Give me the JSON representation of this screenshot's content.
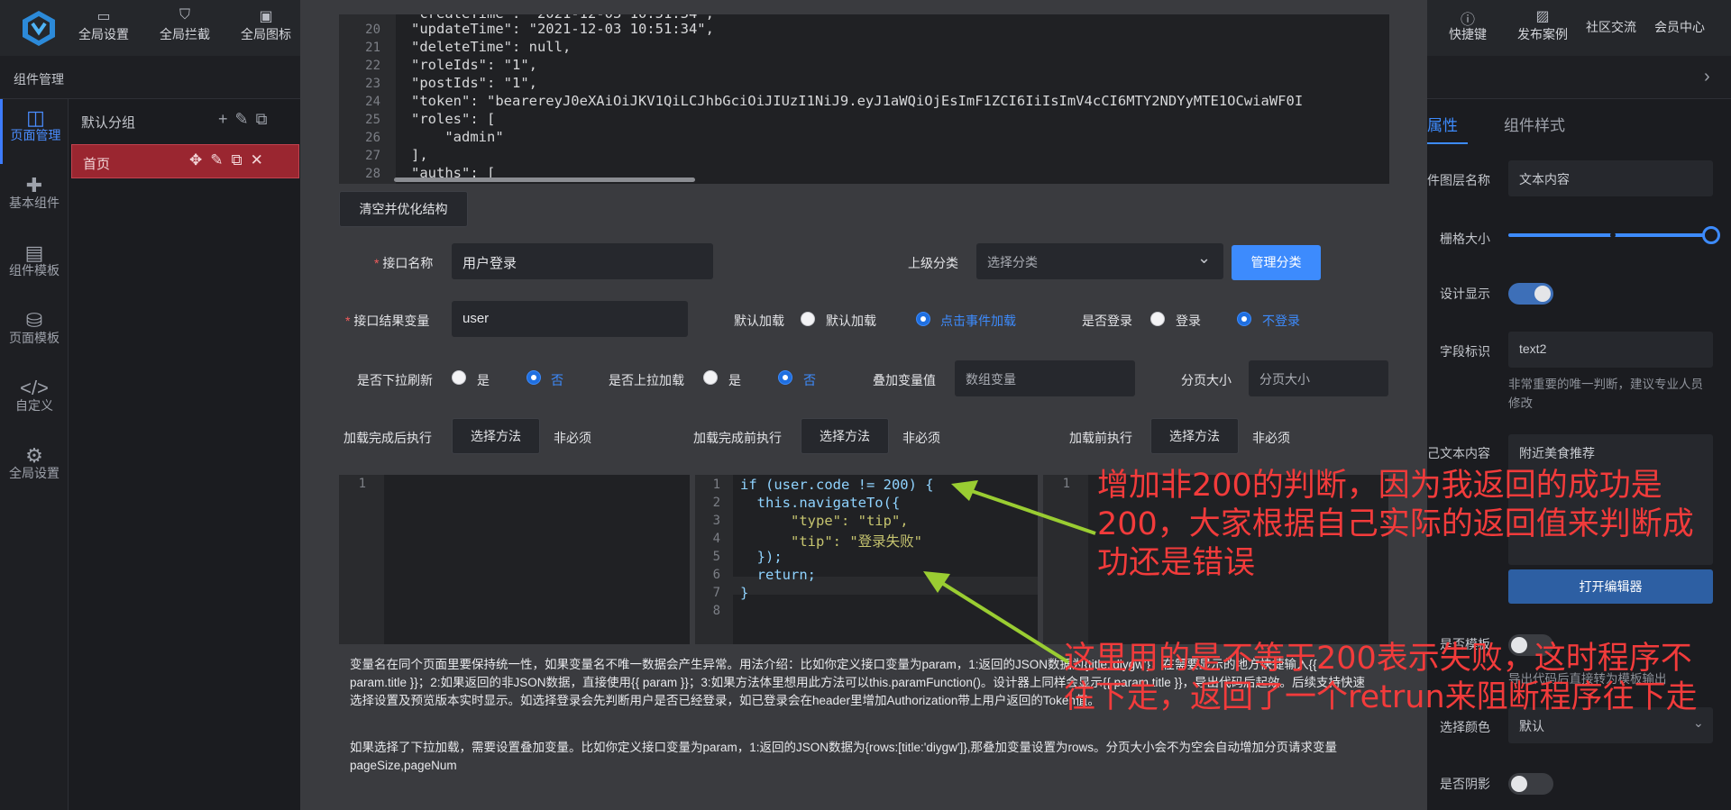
{
  "topbar": {
    "left_buttons": [
      {
        "label": "全局设置",
        "icon": "settings-icon"
      },
      {
        "label": "全局拦截",
        "icon": "shield-icon"
      },
      {
        "label": "全局图标",
        "icon": "icon-library-icon"
      }
    ],
    "right_buttons": [
      {
        "label": "快捷键",
        "icon": "help-icon"
      },
      {
        "label": "发布案例",
        "icon": "image-icon"
      },
      {
        "label": "社区交流"
      },
      {
        "label": "会员中心"
      }
    ]
  },
  "subbar": {
    "title": "组件管理"
  },
  "leftnav": {
    "items": [
      {
        "label": "页面管理",
        "icon": "page-icon",
        "active": true
      },
      {
        "label": "基本组件",
        "icon": "puzzle-icon"
      },
      {
        "label": "组件模板",
        "icon": "template-icon"
      },
      {
        "label": "页面模板",
        "icon": "database-icon"
      },
      {
        "label": "自定义",
        "icon": "code-icon"
      },
      {
        "label": "全局设置",
        "icon": "gear-icon"
      }
    ]
  },
  "pages_panel": {
    "group_title": "默认分组",
    "pages": [
      {
        "label": "首页"
      }
    ]
  },
  "code_top": {
    "lines": [
      {
        "n": "20",
        "code": "\"updateTime\": \"2021-12-03 10:51:34\","
      },
      {
        "n": "21",
        "code": "\"deleteTime\": null,"
      },
      {
        "n": "22",
        "code": "\"roleIds\": \"1\","
      },
      {
        "n": "23",
        "code": "\"postIds\": \"1\","
      },
      {
        "n": "24",
        "code": "\"token\": \"bearereyJ0eXAiOiJKV1QiLCJhbGciOiJIUzI1NiJ9.eyJ1aWQiOjEsImF1ZCI6IiIsImV4cCI6MTY2NDYyMTE1OCwiaWF0I"
      },
      {
        "n": "25",
        "code": "\"roles\": ["
      },
      {
        "n": "26",
        "code": "    \"admin\""
      },
      {
        "n": "27",
        "code": "],"
      },
      {
        "n": "28",
        "code": "\"auths\": ["
      }
    ]
  },
  "form": {
    "clear_button": "清空并优化结构",
    "api_name_label": "接口名称",
    "api_name_value": "用户登录",
    "parent_category_label": "上级分类",
    "parent_category_placeholder": "选择分类",
    "manage_category_button": "管理分类",
    "result_var_label": "接口结果变量",
    "result_var_value": "user",
    "default_load_label": "默认加载",
    "default_load_opt1": "默认加载",
    "default_load_opt2": "点击事件加载",
    "need_login_label": "是否登录",
    "need_login_opt1": "登录",
    "need_login_opt2": "不登录",
    "pull_refresh_label": "是否下拉刷新",
    "pull_up_label": "是否上拉加载",
    "yes": "是",
    "no": "否",
    "stack_var_label": "叠加变量值",
    "stack_var_placeholder": "数组变量",
    "page_size_label": "分页大小",
    "page_size_placeholder": "分页大小",
    "after_load_label": "加载完成后执行",
    "before_complete_label": "加载完成前执行",
    "before_load_label": "加载前执行",
    "choose_method": "选择方法",
    "optional": "非必须"
  },
  "editors": {
    "left": {
      "lines": [
        "1"
      ]
    },
    "middle": {
      "lines": [
        {
          "n": "1",
          "code": "if (user.code != 200) {"
        },
        {
          "n": "2",
          "code": "  this.navigateTo({"
        },
        {
          "n": "3",
          "code": "      \"type\": \"tip\","
        },
        {
          "n": "4",
          "code": "      \"tip\": \"登录失败\""
        },
        {
          "n": "5",
          "code": "  });"
        },
        {
          "n": "6",
          "code": "  return;"
        },
        {
          "n": "7",
          "code": "}"
        },
        {
          "n": "8",
          "code": ""
        }
      ]
    },
    "right": {
      "lines": [
        "1"
      ]
    }
  },
  "help": {
    "p1": "变量名在同个页面里要保持统一性，如果变量名不唯一数据会产生异常。用法介绍：比如你定义接口变量为param，1:返回的JSON数据为{title:'diygw'}，在需要显示的地方快捷输入{{ param.title }}；2:如果返回的非JSON数据，直接使用{{ param }}；3:如果方法体里想用此方法可以this.paramFunction()。设计器上同样会显示{{ param.title }}，导出代码后起效。后续支持快速选择设置及预览版本实时显示。如选择登录会先判断用户是否已经登录，如已登录会在header里增加Authorization带上用户返回的Token值。",
    "p2": "如果选择了下拉加载，需要设置叠加变量。比如你定义接口变量为param，1:返回的JSON数据为{rows:[title:'diygw']},那叠加变量设置为rows。分页大小会不为空会自动增加分页请求变量pageSize,pageNum"
  },
  "annotations": {
    "a1": "增加非200的判断，因为我返回的成功是200，大家根据自己实际的返回值来判断成功还是错误",
    "a2": "这里用的是不等于200表示失败，这时程序不往下走，返回了一个retrun来阻断程序往下走"
  },
  "right_panel": {
    "tab_props": "属性",
    "tab_style": "组件样式",
    "layer_name_label": "件图层名称",
    "layer_name_value": "文本内容",
    "grid_size_label": "栅格大小",
    "grid_size_value": 0.92,
    "design_show_label": "设计显示",
    "design_show_on": true,
    "field_id_label": "字段标识",
    "field_id_value": "text2",
    "field_hint": "非常重要的唯一判断，建议专业人员修改",
    "text_content_label": "己文本内容",
    "text_content_value": "附近美食推荐",
    "open_editor_button": "打开编辑器",
    "is_template_label": "是否模板",
    "template_hint": "导出代码后直接转为模板输出",
    "choose_color_label": "选择颜色",
    "choose_color_value": "默认",
    "shadow_label": "是否阴影"
  },
  "colors": {
    "accent": "#3d8bfd",
    "annotation": "#f23b3b",
    "arrow": "#9acd32",
    "active_page": "#9a2630"
  }
}
